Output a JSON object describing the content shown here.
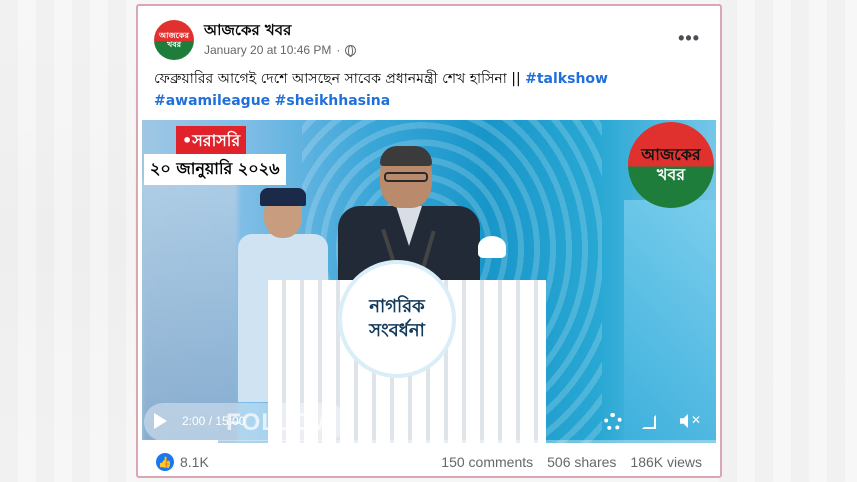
{
  "page": {
    "name": "আজকের খবর",
    "logo_top": "আজকের",
    "logo_bottom": "খবর",
    "timestamp": "January 20 at 10:46 PM",
    "privacy_icon": "globe-icon",
    "more_label": "•••"
  },
  "post": {
    "text": "ফেব্রুয়ারির আগেই দেশে আসছেন সাবেক প্রধানমন্ত্রী শেখ হাসিনা ||",
    "hashtags": [
      "#talkshow",
      "#awamileague",
      "#sheikhhasina"
    ]
  },
  "video": {
    "live_badge": "•সরাসরি",
    "date_badge": "২০ জানুয়ারি ২০২৬",
    "logo_overlay_top": "আজকের",
    "logo_overlay_bottom": "খবর",
    "podium_line1": "নাগরিক",
    "podium_line2": "সংবর্ধনা",
    "time": "2:00 / 15:00",
    "follow_label": "FOLLOW",
    "progress": 0.133,
    "icons": [
      "play-icon",
      "settings-icon",
      "fullscreen-icon",
      "volume-icon"
    ]
  },
  "footer": {
    "likes": "8.1K",
    "comments": "150 comments",
    "shares": "506 shares",
    "views": "186K views"
  },
  "colors": {
    "accent": "#1877f2",
    "hashtag": "#216fdb",
    "live_red": "#e0222a",
    "logo_red": "#e0312f",
    "logo_green": "#1e7d3b",
    "card_border": "#d9a7b4"
  }
}
